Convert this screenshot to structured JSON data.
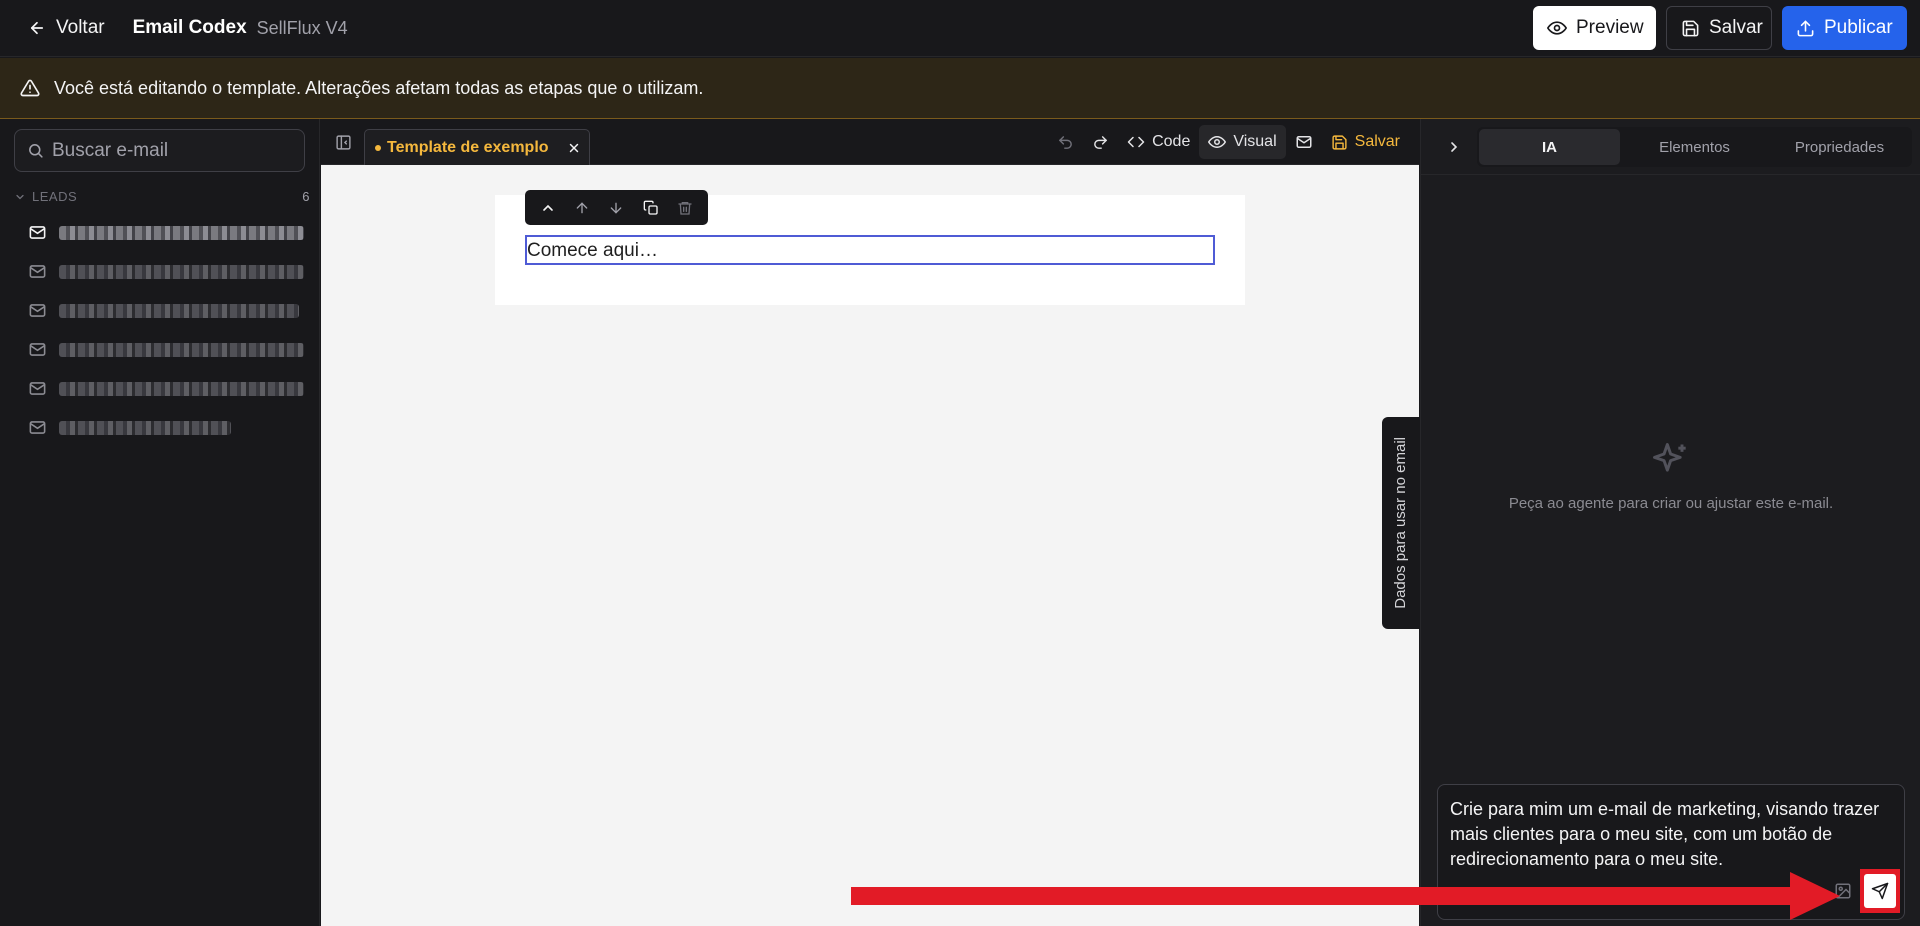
{
  "topbar": {
    "back_label": "Voltar",
    "title": "Email Codex",
    "subtitle": "SellFlux V4",
    "preview_label": "Preview",
    "save_label": "Salvar",
    "publish_label": "Publicar",
    "publish_color": "#2563eb"
  },
  "banner": {
    "message": "Você está editando o template. Alterações afetam todas as etapas que o utilizam.",
    "icon": "warning-icon"
  },
  "sidebar": {
    "search_placeholder": "Buscar e-mail",
    "group_label": "LEADS",
    "group_count": "6",
    "items": [
      {
        "label": "",
        "blurred": true,
        "selected": true
      },
      {
        "label": "",
        "blurred": true
      },
      {
        "label": "",
        "blurred": true
      },
      {
        "label": "",
        "blurred": true
      },
      {
        "label": "",
        "blurred": true
      },
      {
        "label": "",
        "blurred": true
      }
    ]
  },
  "editor": {
    "tab_label": "Template de exemplo",
    "tab_color": "#f5b83d",
    "tools": {
      "code_label": "Code",
      "visual_label": "Visual",
      "save_label": "Salvar"
    },
    "canvas": {
      "text_block_value": "Comece aqui…"
    },
    "side_tab_label": "Dados para usar no email"
  },
  "right_panel": {
    "tabs": [
      {
        "label": "IA",
        "active": true
      },
      {
        "label": "Elementos",
        "active": false
      },
      {
        "label": "Propriedades",
        "active": false
      }
    ],
    "empty_message": "Peça ao agente para criar ou ajustar este e-mail.",
    "chat_input_value": "Crie para mim um e-mail de marketing, visando trazer mais clientes para o meu site, com um botão de redirecionamento para o meu site."
  },
  "annotation": {
    "color": "#e21b26"
  }
}
